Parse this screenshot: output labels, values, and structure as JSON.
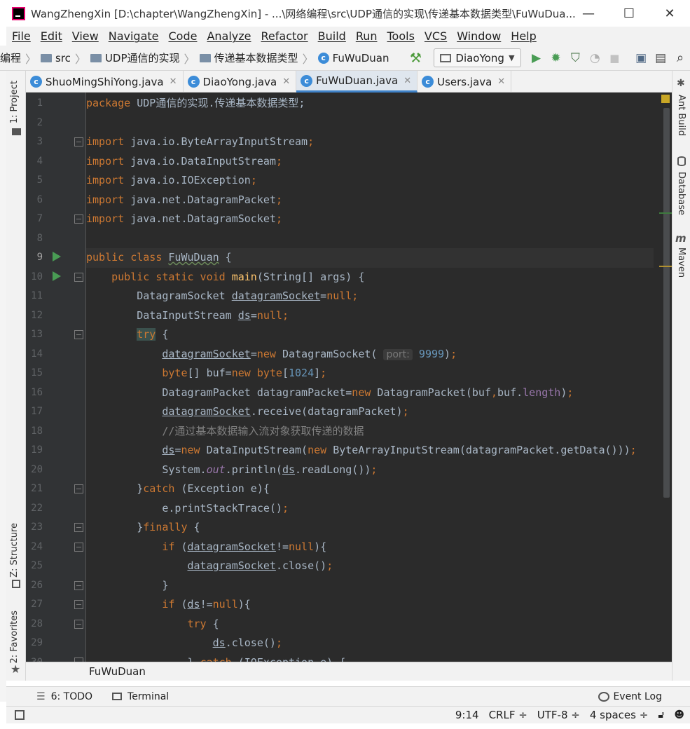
{
  "window": {
    "title": "WangZhengXin [D:\\chapter\\WangZhengXin] - ...\\网络编程\\src\\UDP通信的实现\\传递基本数据类型\\FuWuDua...",
    "minimize": "—",
    "maximize": "☐",
    "close": "✕"
  },
  "menu": [
    "File",
    "Edit",
    "View",
    "Navigate",
    "Code",
    "Analyze",
    "Refactor",
    "Build",
    "Run",
    "Tools",
    "VCS",
    "Window",
    "Help"
  ],
  "nav": {
    "crumbs": [
      "编程",
      "src",
      "UDP通信的实现",
      "传递基本数据类型",
      "FuWuDuan"
    ],
    "run_config": "DiaoYong"
  },
  "tabs": [
    {
      "label": "ShuoMingShiYong.java",
      "active": false
    },
    {
      "label": "DiaoYong.java",
      "active": false
    },
    {
      "label": "FuWuDuan.java",
      "active": true
    },
    {
      "label": "Users.java",
      "active": false
    }
  ],
  "left_tools": [
    "1: Project",
    "Z: Structure",
    "2: Favorites"
  ],
  "right_tools": [
    "Ant Build",
    "Database",
    "Maven"
  ],
  "editor": {
    "line_numbers": [
      "1",
      "2",
      "3",
      "4",
      "5",
      "6",
      "7",
      "8",
      "9",
      "10",
      "11",
      "12",
      "13",
      "14",
      "15",
      "16",
      "17",
      "18",
      "19",
      "20",
      "21",
      "22",
      "23",
      "24",
      "25",
      "26",
      "27",
      "28",
      "29",
      "30"
    ],
    "comment_line": "//通过基本数据输入流对象获取传递的数据",
    "package_name": "UDP通信的实现.传递基本数据类型",
    "param_hint": "port:",
    "port_value": "9999",
    "buffer_size": "1024"
  },
  "footer_breadcrumb": "FuWuDuan",
  "toolwindows": [
    {
      "label": "6: TODO"
    },
    {
      "label": "Terminal"
    }
  ],
  "event_log": "Event Log",
  "status": {
    "position": "9:14",
    "line_sep": "CRLF ÷",
    "encoding": "UTF-8 ÷",
    "indent": "4 spaces ÷"
  },
  "colors": {
    "editor_bg": "#2b2b2b",
    "keyword": "#cc7832",
    "function": "#ffc66d",
    "number": "#6897bb",
    "field": "#9876aa",
    "run_green": "#499c54",
    "active_tab_accent": "#4083c9"
  }
}
